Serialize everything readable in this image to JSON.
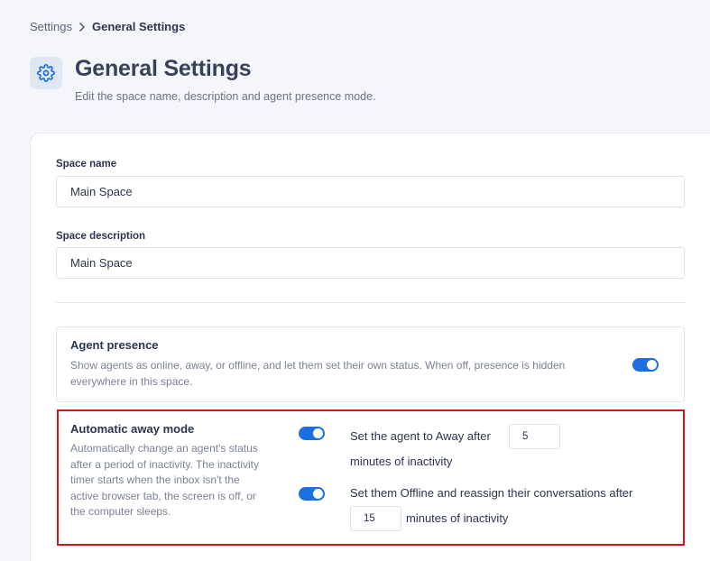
{
  "breadcrumb": {
    "root": "Settings",
    "current": "General Settings"
  },
  "header": {
    "icon": "gear-icon",
    "title": "General Settings",
    "subtitle": "Edit the space name, description and agent presence mode."
  },
  "form": {
    "space_name": {
      "label": "Space name",
      "value": "Main Space"
    },
    "space_description": {
      "label": "Space description",
      "value": "Main Space"
    }
  },
  "agent_presence": {
    "title": "Agent presence",
    "description_line1": "Show agents as online, away, or offline, and let them set their own status. When off, presence is hidden",
    "description_line2": "everywhere in this space.",
    "enabled": true
  },
  "away_mode": {
    "title": "Automatic away mode",
    "description_lines": [
      "Automatically change an agent's status",
      "after a period of inactivity. The inactivity",
      "timer starts when the inbox isn't the",
      "active browser tab, the screen is off, or",
      "the computer sleeps."
    ],
    "away": {
      "enabled": true,
      "prefix": "Set the agent to Away after",
      "minutes": "5",
      "suffix": "minutes of inactivity"
    },
    "offline": {
      "enabled": true,
      "prefix": "Set them Offline and reassign their conversations after",
      "minutes": "15",
      "suffix": "minutes of inactivity"
    }
  },
  "colors": {
    "accent": "#1b6fe0",
    "highlight_border": "#d0161e",
    "background": "#f4f6f9"
  }
}
